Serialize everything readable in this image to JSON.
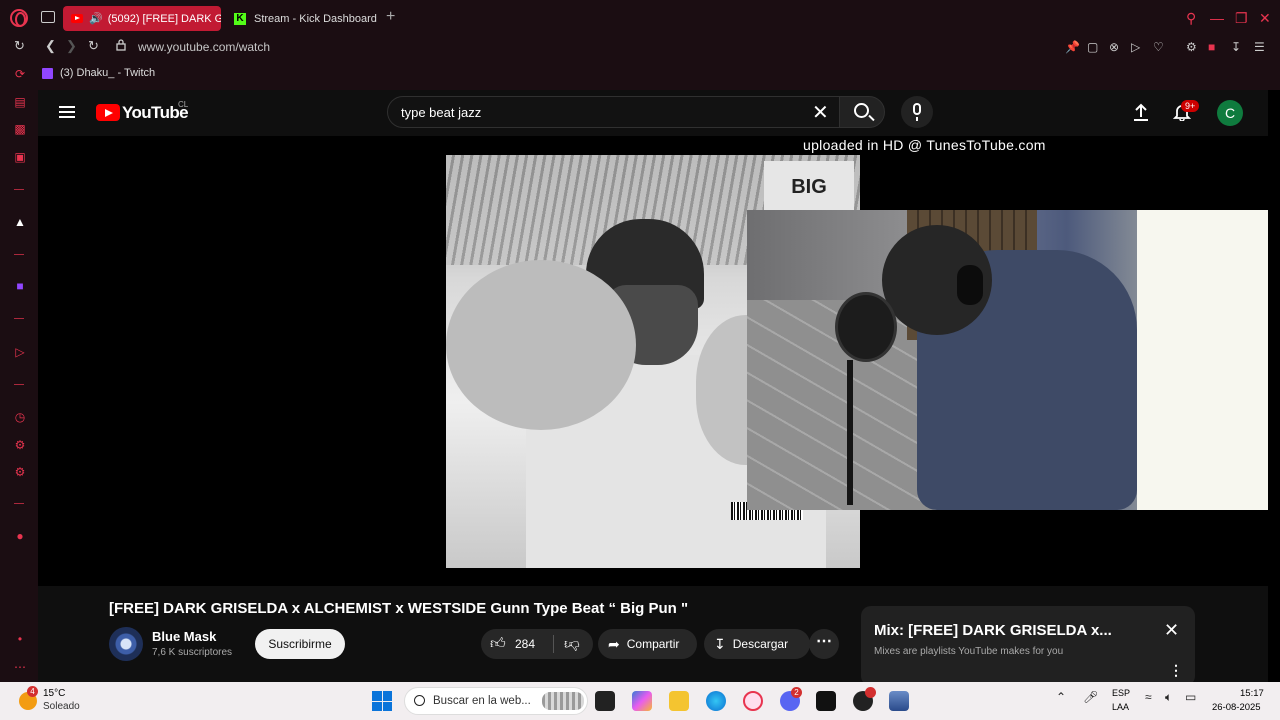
{
  "browser": {
    "tabs": [
      {
        "label": "(5092) [FREE] DARK G",
        "active": true
      },
      {
        "label": "Stream - Kick Dashboard",
        "active": false
      }
    ],
    "url": "www.youtube.com/watch",
    "bookmark": {
      "label": "(3) Dhaku_ - Twitch"
    },
    "accent_color": "#e8344f"
  },
  "youtube": {
    "logo_text": "YouTube",
    "country_code": "CL",
    "search_query": "type beat jazz",
    "notifications": "9+",
    "avatar_letter": "C",
    "video_overlay_text": "uploaded in HD @ TunesToTube.com",
    "album_sign": "BIG",
    "video_title": "[FREE] DARK GRISELDA x ALCHEMIST x WESTSIDE Gunn Type Beat “ Big Pun \"",
    "channel": {
      "name": "Blue Mask",
      "subscribers": "7,6 K suscriptores",
      "subscribe_label": "Suscribirme"
    },
    "likes": "284",
    "share_label": "Compartir",
    "download_label": "Descargar",
    "mix": {
      "title": "Mix: [FREE] DARK GRISELDA x...",
      "subtitle": "Mixes are playlists YouTube makes for you"
    }
  },
  "taskbar": {
    "weather": {
      "temp": "15°C",
      "condition": "Soleado",
      "badge": "4"
    },
    "search_placeholder": "Buscar en la web...",
    "discord_badge": "2",
    "language_1": "ESP",
    "language_2": "LAA",
    "time": "15:17",
    "date": "26-08-2025"
  }
}
